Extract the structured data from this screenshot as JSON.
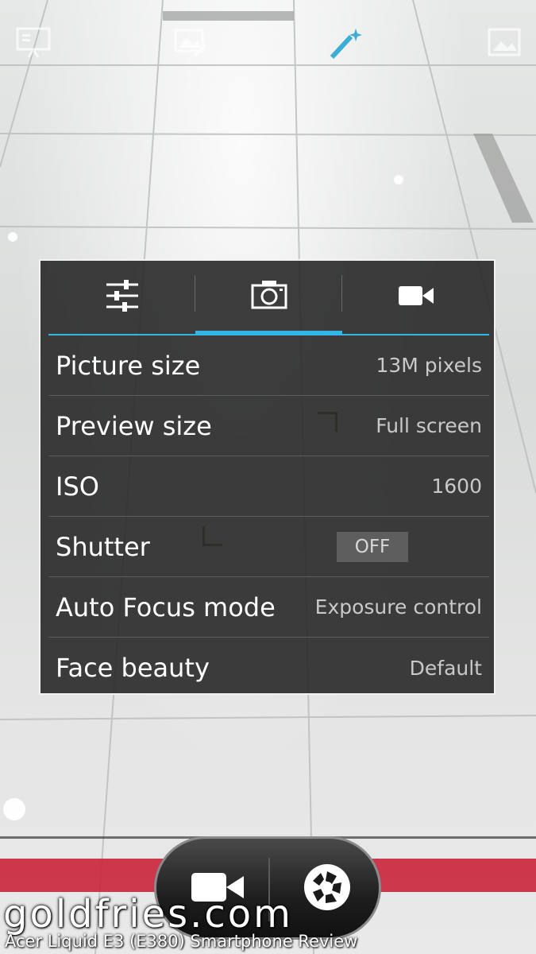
{
  "top_icons": [
    "slideshow-icon",
    "gallery-edit-icon",
    "effects-icon",
    "gallery-icon"
  ],
  "tabs": [
    {
      "name": "general-settings",
      "icon": "sliders-icon",
      "active": false
    },
    {
      "name": "camera-settings",
      "icon": "camera-icon",
      "active": true
    },
    {
      "name": "video-settings",
      "icon": "video-camera-icon",
      "active": false
    }
  ],
  "settings": [
    {
      "label": "Picture size",
      "value": "13M pixels"
    },
    {
      "label": "Preview size",
      "value": "Full screen"
    },
    {
      "label": "ISO",
      "value": "1600"
    },
    {
      "label": "Shutter",
      "value": "OFF"
    },
    {
      "label": "Auto Focus mode",
      "value": "Exposure control"
    },
    {
      "label": "Face beauty",
      "value": "Default"
    }
  ],
  "controls": {
    "left": "video-record-icon",
    "right": "shutter-icon"
  },
  "watermark": {
    "site": "goldfries.com",
    "subtitle": "Acer Liquid E3 (E380) Smartphone Review"
  },
  "colors": {
    "accent": "#33b5e5",
    "panel_bg": "#282828",
    "stripe": "#c9283f"
  }
}
